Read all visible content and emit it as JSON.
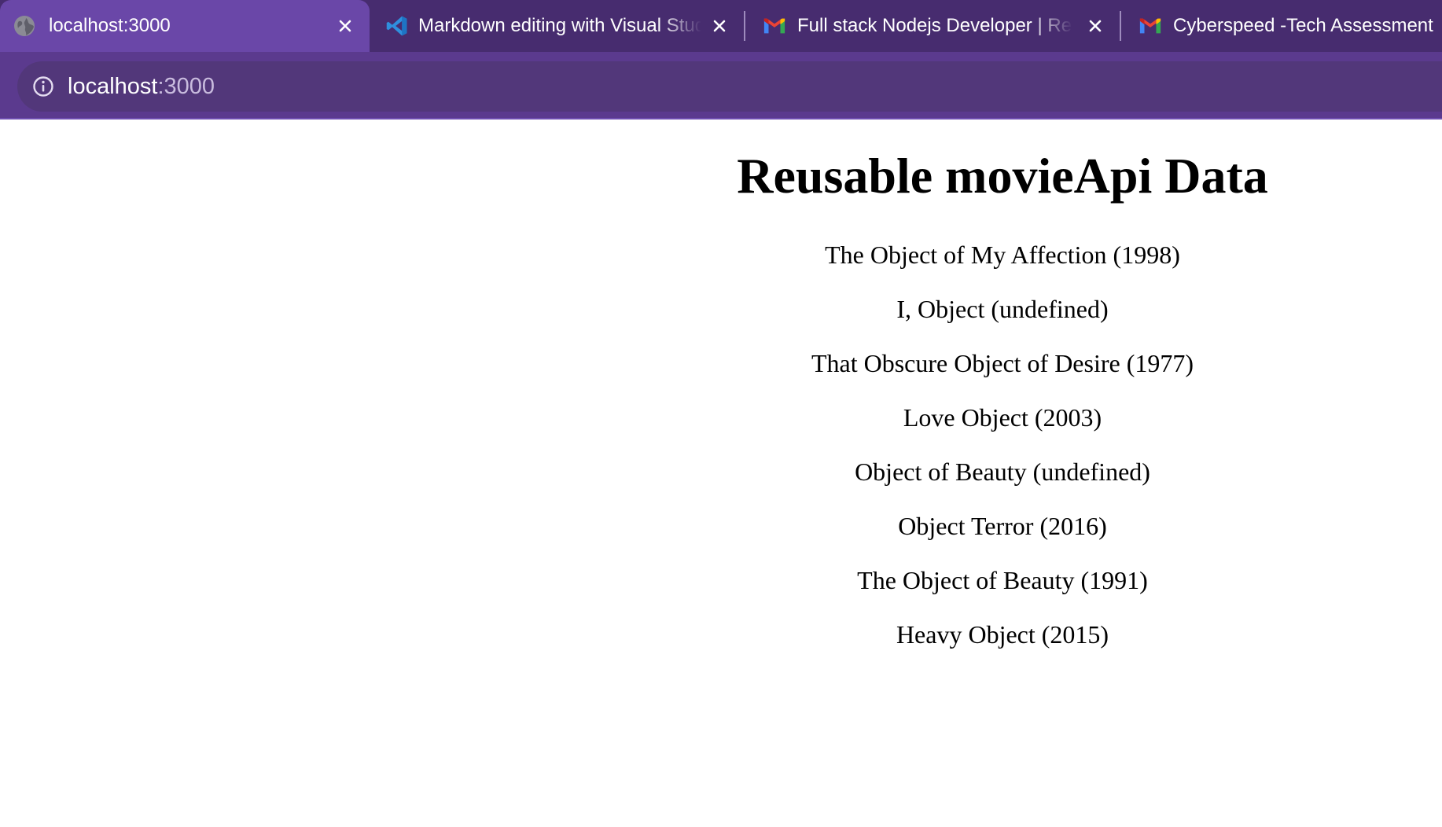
{
  "tabs": [
    {
      "title": "localhost:3000",
      "icon": "globe-icon",
      "active": true
    },
    {
      "title": "Markdown editing with Visual Studio Code",
      "icon": "vscode-icon",
      "active": false
    },
    {
      "title": "Full stack Nodejs Developer | Remote",
      "icon": "gmail-icon",
      "active": false
    },
    {
      "title": "Cyberspeed -Tech Assessment",
      "icon": "gmail-icon",
      "active": false
    }
  ],
  "address_bar": {
    "host": "localhost",
    "port": ":3000",
    "icon": "info-icon"
  },
  "page": {
    "title": "Reusable movieApi Data",
    "movies": [
      "The Object of My Affection (1998)",
      "I, Object (undefined)",
      "That Obscure Object of Desire (1977)",
      "Love Object (2003)",
      "Object of Beauty (undefined)",
      "Object Terror (2016)",
      "The Object of Beauty (1991)",
      "Heavy Object (2015)"
    ]
  },
  "colors": {
    "chrome_background": "#5b3a8e",
    "tab_strip": "#472c6f",
    "active_tab": "#6a47a8",
    "address_bar": "#52377a",
    "port_text": "#c9bcde"
  }
}
